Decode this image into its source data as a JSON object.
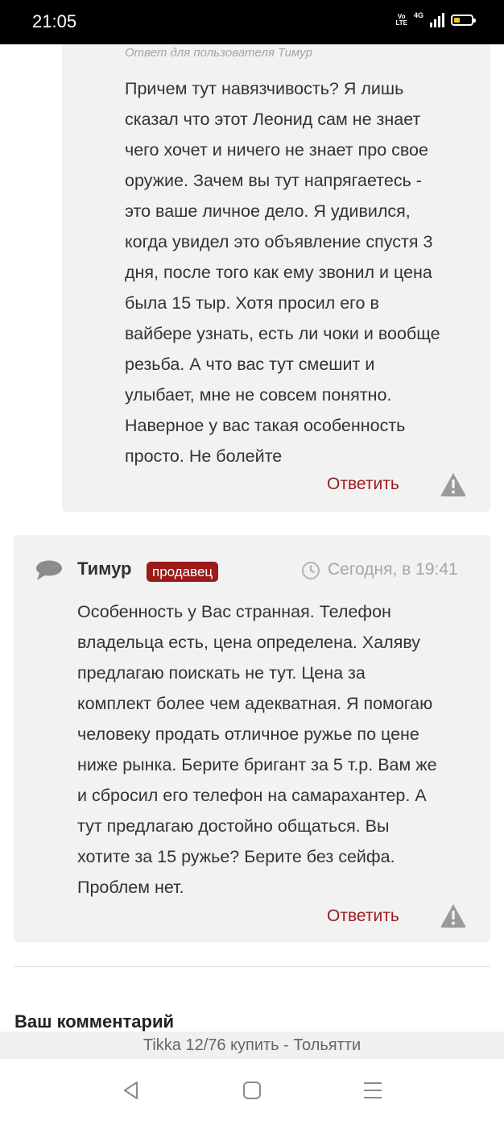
{
  "status_bar": {
    "time": "21:05",
    "volte": "Vo\nLTE",
    "network": "4G",
    "battery_level": 0.35
  },
  "reply_card": {
    "reply_to": "Ответ для пользователя Тимур",
    "text": "Причем тут навязчивость? Я лишь\nсказал что этот Леонид сам не знает\nчего хочет и ничего не знает про свое\nоружие. Зачем вы тут напрягаетесь -\nэто ваше личное дело. Я удивился,\nкогда увидел это объявление спустя 3\nдня, после того как ему звонил и цена\nбыла 15 тыр. Хотя просил его в\nвайбере узнать, есть ли чоки и вообще\nрезьба. А что вас тут смешит и\nулыбает, мне не совсем понятно.\nНаверное у вас такая особенность\nпросто. Не болейте",
    "reply_label": "Ответить",
    "report_icon": "warning-icon"
  },
  "comment_card": {
    "author": "Тимур",
    "badge": "продавец",
    "date": "Сегодня, в 19:41",
    "text": "Особенность у Вас странная. Телефон\nвладельца есть, цена определена. Халяву\nпредлагаю поискать не тут. Цена за\nкомплект более чем адекватная. Я помогаю\nчеловеку продать отличное ружье по цене\nниже рынка. Берите бригант за 5 т.р. Вам же\nи сбросил его телефон на самарахантер. А\nтут предлагаю достойно общаться. Вы\nхотите за 15 ружье? Берите без сейфа.\nПроблем нет.",
    "reply_label": "Ответить",
    "report_icon": "warning-icon"
  },
  "comment_form": {
    "heading": "Ваш комментарий"
  },
  "url_bar": {
    "title": "Tikka 12/76 купить - Тольятти"
  },
  "colors": {
    "accent": "#9b1b1b",
    "card_bg": "#f2f2f2",
    "muted": "#a6a6a6",
    "text": "#333333"
  }
}
